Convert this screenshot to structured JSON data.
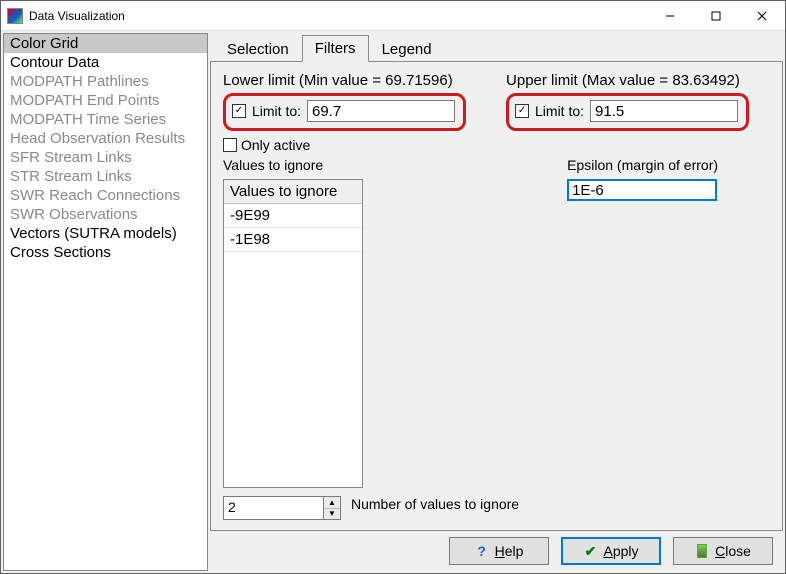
{
  "window": {
    "title": "Data Visualization"
  },
  "sidebar": {
    "items": [
      {
        "label": "Color Grid",
        "disabled": false,
        "selected": true
      },
      {
        "label": "Contour Data",
        "disabled": false,
        "selected": false
      },
      {
        "label": "MODPATH Pathlines",
        "disabled": true,
        "selected": false
      },
      {
        "label": "MODPATH End Points",
        "disabled": true,
        "selected": false
      },
      {
        "label": "MODPATH Time Series",
        "disabled": true,
        "selected": false
      },
      {
        "label": "Head Observation Results",
        "disabled": true,
        "selected": false
      },
      {
        "label": "SFR Stream Links",
        "disabled": true,
        "selected": false
      },
      {
        "label": "STR Stream Links",
        "disabled": true,
        "selected": false
      },
      {
        "label": "SWR Reach Connections",
        "disabled": true,
        "selected": false
      },
      {
        "label": "SWR Observations",
        "disabled": true,
        "selected": false
      },
      {
        "label": "Vectors (SUTRA models)",
        "disabled": false,
        "selected": false
      },
      {
        "label": "Cross Sections",
        "disabled": false,
        "selected": false
      }
    ]
  },
  "tabs": {
    "items": [
      {
        "label": "Selection",
        "active": false
      },
      {
        "label": "Filters",
        "active": true
      },
      {
        "label": "Legend",
        "active": false
      }
    ]
  },
  "filters": {
    "lower": {
      "caption": "Lower limit (Min value = 69.71596)",
      "checkbox_label": "Limit to:",
      "checked": true,
      "value": "69.7"
    },
    "upper": {
      "caption": "Upper limit (Max value = 83.63492)",
      "checkbox_label": "Limit to:",
      "checked": true,
      "value": "91.5"
    },
    "only_active": {
      "label": "Only active",
      "checked": false
    },
    "values_to_ignore": {
      "label": "Values to ignore",
      "header": "Values to ignore",
      "rows": [
        "-9E99",
        "-1E98"
      ]
    },
    "epsilon": {
      "label": "Epsilon (margin of error)",
      "value": "1E-6"
    },
    "ignore_count": {
      "value": "2",
      "label": "Number of values to ignore"
    }
  },
  "buttons": {
    "help": "Help",
    "apply": "Apply",
    "close": "Close"
  }
}
